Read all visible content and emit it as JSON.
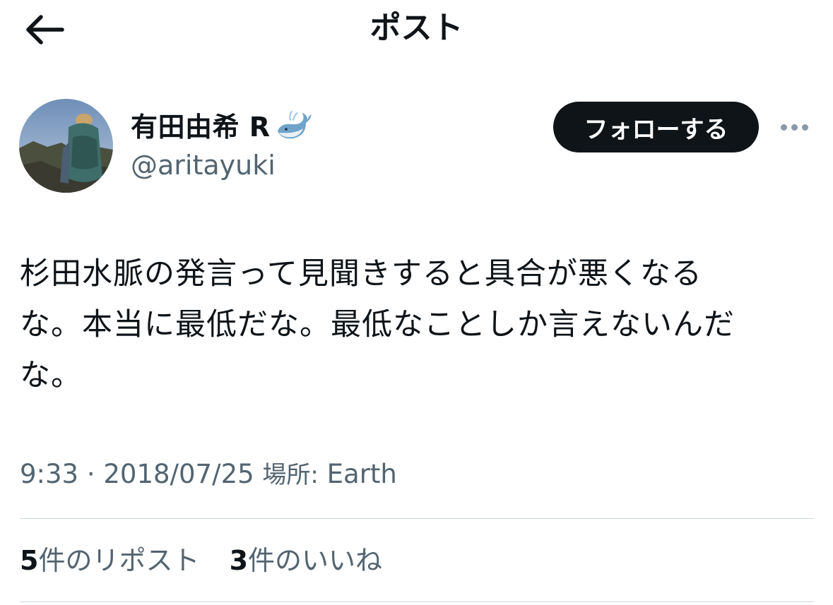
{
  "header": {
    "title": "ポスト",
    "back_icon": "arrow-left-icon"
  },
  "author": {
    "display_name": "有田由希 R",
    "badge_icon": "whale-icon",
    "handle": "@aritayuki",
    "avatar_icon": "profile-photo"
  },
  "follow_button": {
    "label": "フォローする"
  },
  "more_icon": "more-horizontal-icon",
  "tweet": {
    "text_line1": "杉田水脈の発言って見聞きすると具合が悪くなる",
    "text_line2": "な。本当に最低だな。最低なことしか言えないんだ",
    "text_line3": "な。"
  },
  "meta": {
    "time": "9:33",
    "separator": " · ",
    "date": "2018/07/25",
    "location_label": "場所:",
    "location": "Earth"
  },
  "stats": {
    "reposts_count": "5",
    "reposts_label": "件のリポスト",
    "likes_count": "3",
    "likes_label": "件のいいね"
  },
  "colors": {
    "text_primary": "#0f1419",
    "text_secondary": "#536471",
    "button_bg": "#0f1419",
    "divider": "#cfd9de"
  }
}
